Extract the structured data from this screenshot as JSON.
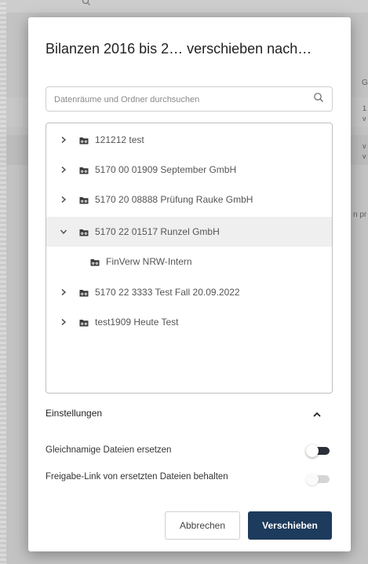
{
  "background": {
    "column_header": "G",
    "rows": [
      [
        "1",
        "v"
      ],
      [
        "v",
        "v"
      ]
    ],
    "side_text": "n pr"
  },
  "dialog": {
    "title": "Bilanzen 2016 bis 2… verschieben nach…",
    "search": {
      "placeholder": "Datenräume und Ordner durchsuchen",
      "value": "",
      "icon": "search-icon"
    },
    "tree": [
      {
        "label": "121212 test",
        "expanded": false,
        "level": 0,
        "selected": false
      },
      {
        "label": "5170 00 01909 September GmbH",
        "expanded": false,
        "level": 0,
        "selected": false
      },
      {
        "label": "5170 20 08888 Prüfung Rauke GmbH",
        "expanded": false,
        "level": 0,
        "selected": false
      },
      {
        "label": "5170 22 01517 Runzel GmbH",
        "expanded": true,
        "level": 0,
        "selected": true
      },
      {
        "label": "FinVerw NRW-Intern",
        "expanded": false,
        "level": 1,
        "selected": false
      },
      {
        "label": "5170 22 3333 Test Fall 20.09.2022",
        "expanded": false,
        "level": 0,
        "selected": false
      },
      {
        "label": "test1909 Heute Test",
        "expanded": false,
        "level": 0,
        "selected": false
      }
    ],
    "settings": {
      "title": "Einstellungen",
      "options": [
        {
          "label": "Gleichnamige Dateien ersetzen",
          "enabled": false,
          "active": true
        },
        {
          "label": "Freigabe-Link von ersetzten Dateien behalten",
          "enabled": false,
          "active": false
        }
      ]
    },
    "buttons": {
      "cancel": "Abbrechen",
      "confirm": "Verschieben"
    }
  },
  "colors": {
    "primary": "#1d3b5c",
    "toggle_track_active": "#2b2f3a",
    "toggle_track_disabled": "#d5d5d5",
    "folder_icon": "#3c3c3c"
  }
}
